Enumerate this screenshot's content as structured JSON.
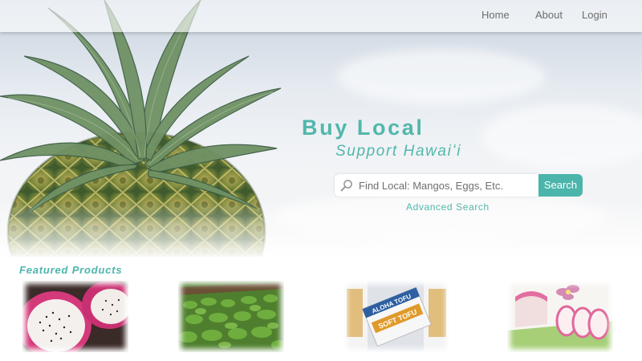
{
  "nav": {
    "home": "Home",
    "about": "About",
    "login": "Login"
  },
  "hero": {
    "title": "Buy Local",
    "subtitle": "Support Hawaiʻi",
    "search_placeholder": "Find Local: Mangos, Eggs, Etc.",
    "search_button": "Search",
    "advanced_search": "Advanced Search"
  },
  "featured": {
    "title": "Featured Products",
    "products": [
      "dragon-fruit",
      "leafy-greens",
      "aloha-tofu",
      "kamaboko"
    ]
  },
  "tofu_label": {
    "brand": "ALOHA TOFU",
    "product": "SOFT TOFU"
  },
  "colors": {
    "accent": "#4bb5ab",
    "nav_text": "#6d6d6d"
  }
}
